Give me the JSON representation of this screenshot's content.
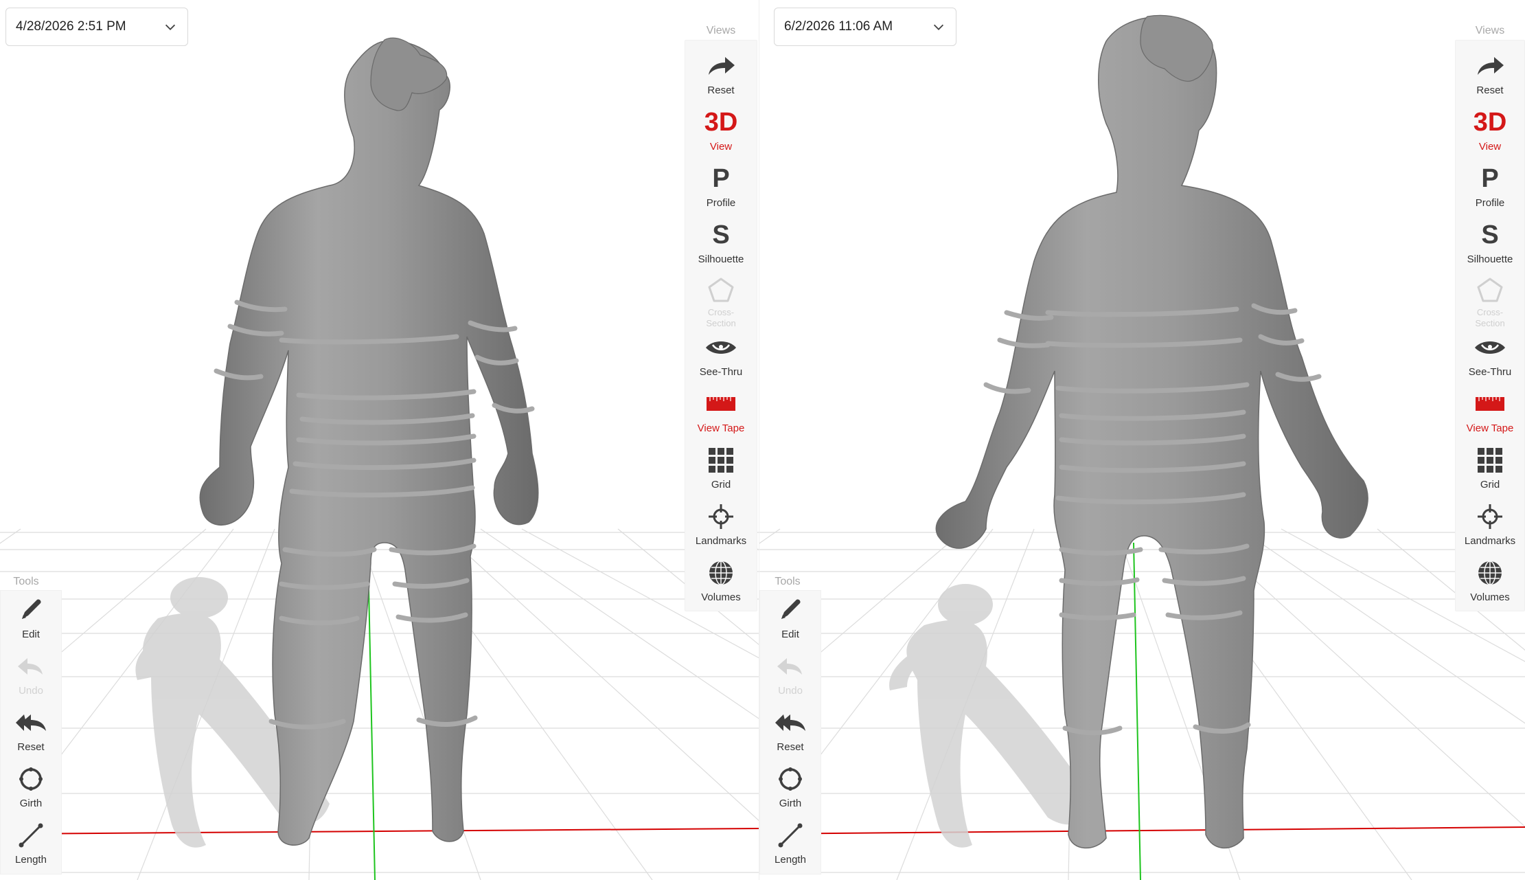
{
  "left_panel": {
    "date_label": "4/28/2026 2:51 PM"
  },
  "right_panel": {
    "date_label": "6/2/2026 11:06 AM"
  },
  "views": {
    "title": "Views",
    "items": [
      {
        "label": "Reset",
        "icon": "redo-arrow-icon",
        "state": "normal"
      },
      {
        "label": "View",
        "icon": "3d-icon",
        "glyph": "3D",
        "state": "active"
      },
      {
        "label": "Profile",
        "icon": "profile-p-icon",
        "glyph": "P",
        "state": "normal"
      },
      {
        "label": "Silhouette",
        "icon": "silhouette-s-icon",
        "glyph": "S",
        "state": "normal"
      },
      {
        "label": "Cross-Section",
        "icon": "pentagon-icon",
        "state": "disabled"
      },
      {
        "label": "See-Thru",
        "icon": "eye-icon",
        "state": "normal"
      },
      {
        "label": "View Tape",
        "icon": "tape-measure-icon",
        "state": "active"
      },
      {
        "label": "Grid",
        "icon": "grid-icon",
        "state": "normal"
      },
      {
        "label": "Landmarks",
        "icon": "crosshair-icon",
        "state": "normal"
      },
      {
        "label": "Volumes",
        "icon": "globe-icon",
        "state": "normal"
      }
    ]
  },
  "tools": {
    "title": "Tools",
    "items": [
      {
        "label": "Edit",
        "icon": "pencil-icon",
        "state": "normal"
      },
      {
        "label": "Undo",
        "icon": "undo-icon",
        "state": "disabled"
      },
      {
        "label": "Reset",
        "icon": "double-back-arrow-icon",
        "state": "normal"
      },
      {
        "label": "Girth",
        "icon": "girth-ring-icon",
        "state": "normal"
      },
      {
        "label": "Length",
        "icon": "length-line-icon",
        "state": "normal"
      }
    ]
  },
  "colors": {
    "accent_red": "#d41818",
    "icon_dark": "#3f3f3f",
    "body_mesh": "#8a8a8a",
    "grid_line": "#dcdcdc",
    "x_axis": "#d40000",
    "y_axis": "#1ec41e"
  }
}
